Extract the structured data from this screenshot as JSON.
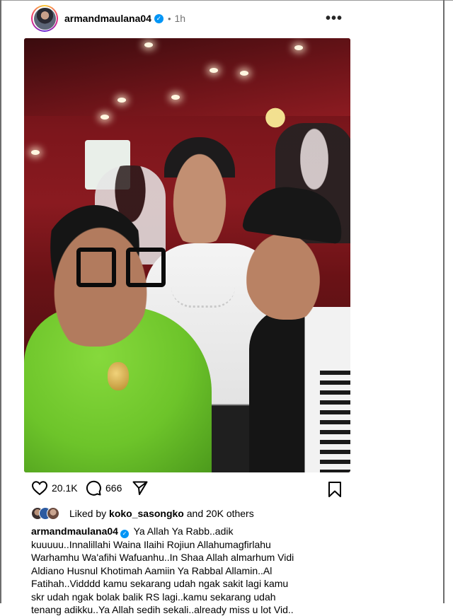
{
  "post": {
    "username": "armandmaulana04",
    "time": "1h",
    "dot": "•",
    "more": "•••"
  },
  "actions": {
    "likes_count": "20.1K",
    "comments_count": "666"
  },
  "liked_by": {
    "prefix": "Liked by",
    "user": "koko_sasongko",
    "suffix": "and 20K others"
  },
  "caption": {
    "username": "armandmaulana04",
    "text": "Ya Allah Ya Rabb..adik kuuuuu..Innalillahi Waina Ilaihi Rojiun Allahumagfirlahu Warhamhu Wa'afihi Wafuanhu..In Shaa Allah almarhum Vidi Aldiano Husnul Khotimah Aamiin Ya Rabbal Allamin..Al Fatihah..Vidddd kamu sekarang udah ngak sakit lagi kamu skr udah ngak bolak balik RS lagi..kamu sekarang udah tenang adikku..Ya Allah sedih sekali..already miss u lot Vid.."
  },
  "colors": {
    "verified": "#0095f6",
    "muted_text": "#737373",
    "jacket_green": "#6dc42a",
    "wall_red": "#8a1a20"
  },
  "icons": [
    "heart-icon",
    "comment-icon",
    "share-icon",
    "bookmark-icon",
    "verified-icon",
    "more-icon"
  ]
}
